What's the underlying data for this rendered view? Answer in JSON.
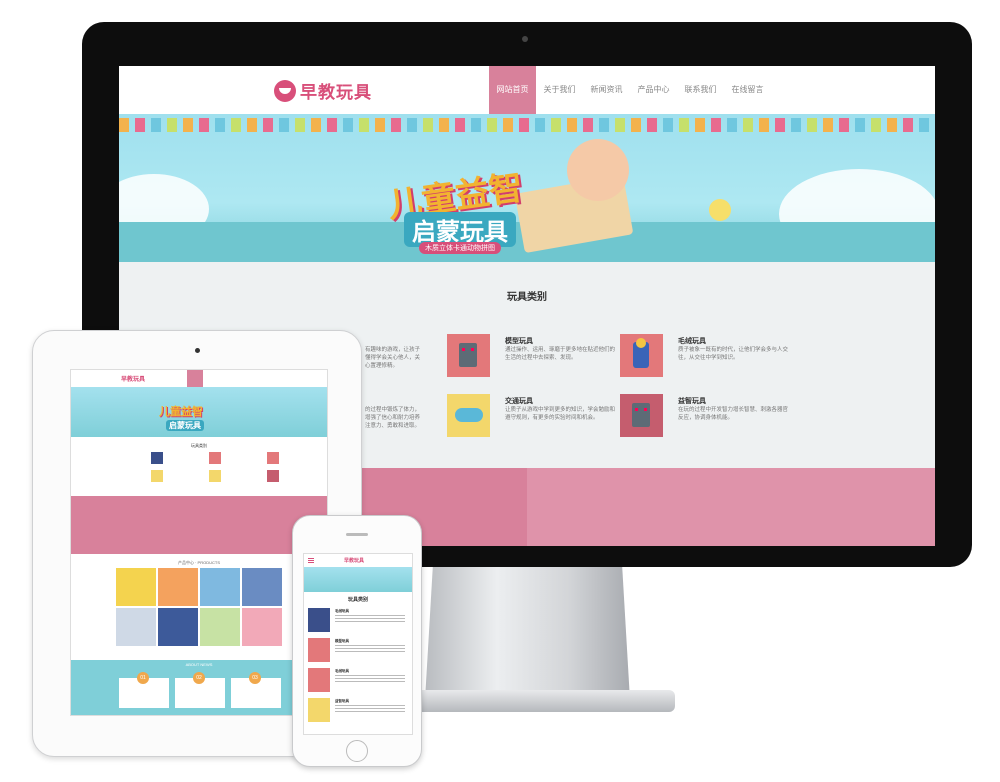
{
  "desktop": {
    "logo_text": "早教玩具",
    "menu": [
      "网站首页",
      "关于我们",
      "新闻资讯",
      "产品中心",
      "联系我们",
      "在线留言"
    ],
    "banner": {
      "title_line1": "儿童益智",
      "title_line2": "启蒙玩具",
      "tagline": "木质立体卡通动物拼图"
    },
    "section_title": "玩具类别",
    "categories": [
      {
        "name": "模型玩具",
        "desc": "通过操作、运用、琢磨于更多地在贴近他们的生活的过程中去探索、发现。"
      },
      {
        "name": "毛绒玩具",
        "desc": "质子被象一既有的时代，让他们学会多与人交往，从交往中学到知识。"
      },
      {
        "name": "交通玩具",
        "desc": "让质子从游戏中学到更多的知识，学会勉励和遵守规则，有更多的实验时间和机会。"
      },
      {
        "name": "益智玩具",
        "desc": "在玩的过程中开发智力增长智慧、刺激各器官反应，协调身体机能。"
      }
    ],
    "left_fragments": [
      "有趣味的游戏，让孩子懂得学会关心他人，关心置理修精。",
      "的过程中锻炼了体力，增强了信心和耐力培养注意力、勇敢和进取。"
    ]
  },
  "tablet": {
    "logo_text": "早教玩具",
    "banner_title1": "儿童益智",
    "banner_title2": "启蒙玩具",
    "category_title": "玩具类别",
    "products_title": "产品中心 · PRODUCTS",
    "news_title": "ABOUT NEWS",
    "news_numbers": [
      "01",
      "02",
      "03"
    ]
  },
  "phone": {
    "logo_text": "早教玩具",
    "category_title": "玩具类别",
    "items": [
      "毛绒玩具",
      "模型玩具",
      "毛绒玩具",
      "益智玩具"
    ]
  }
}
